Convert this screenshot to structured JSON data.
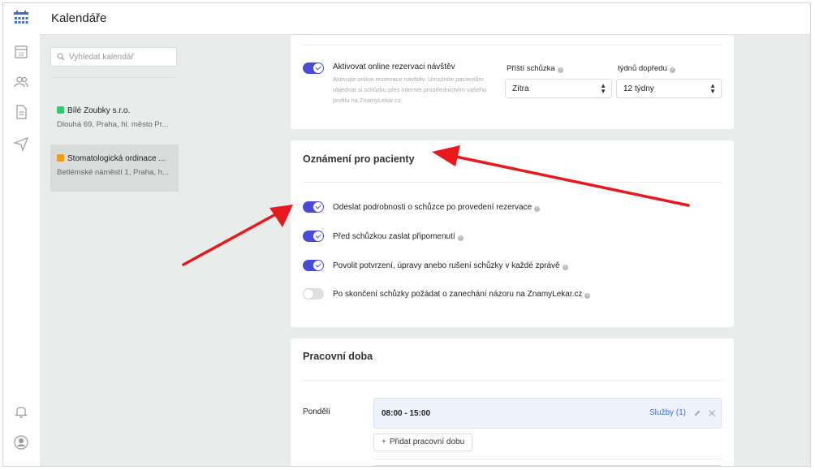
{
  "app": {
    "title": "Kalendáře"
  },
  "sidebar": {
    "search_placeholder": "Vyhledat kalendář",
    "calendars": [
      {
        "name": "Bílé Zoubky s.r.o.",
        "address": "Dlouhá 69, Praha, hl. město Pr...",
        "color": "#2ecc71"
      },
      {
        "name": "Stomatologická ordinace ...",
        "address": "Betlémské náměstí 1, Praha, h...",
        "color": "#f39c12"
      }
    ]
  },
  "online_booking": {
    "toggle_label": "Aktivovat online rezervaci návštěv",
    "toggle_on": true,
    "description": "Aktivujte online rezervace návštěv. Umožníte pacientům objednat si schůzku přes internet prostřednictvím vašeho profilu na ZnamyLekar.cz.",
    "next_label": "Příští schůzka",
    "next_value": "Zítra",
    "weeks_label": "týdnů dopředu",
    "weeks_value": "12 týdny"
  },
  "notifications": {
    "title": "Oznámení pro pacienty",
    "items": [
      {
        "label": "Odeslat podrobnosti o schůzce po provedení rezervace",
        "on": true
      },
      {
        "label": "Před schůzkou zaslat připomenutí",
        "on": true
      },
      {
        "label": "Povolit potvrzení, úpravy anebo rušení schůzky v každé zprávě",
        "on": true
      },
      {
        "label": "Po skončení schůzky požádat o zanechání názoru na ZnamyLekar.cz",
        "on": false
      }
    ]
  },
  "working_hours": {
    "title": "Pracovní doba",
    "day": "Pondělí",
    "time": "08:00 - 15:00",
    "services_link": "Služby (1)",
    "add_button": "Přidat pracovní dobu"
  },
  "colors": {
    "accent": "#4a4ad8",
    "link": "#3b6fd8",
    "arrow": "#e8191c",
    "background": "#e8ecea"
  }
}
